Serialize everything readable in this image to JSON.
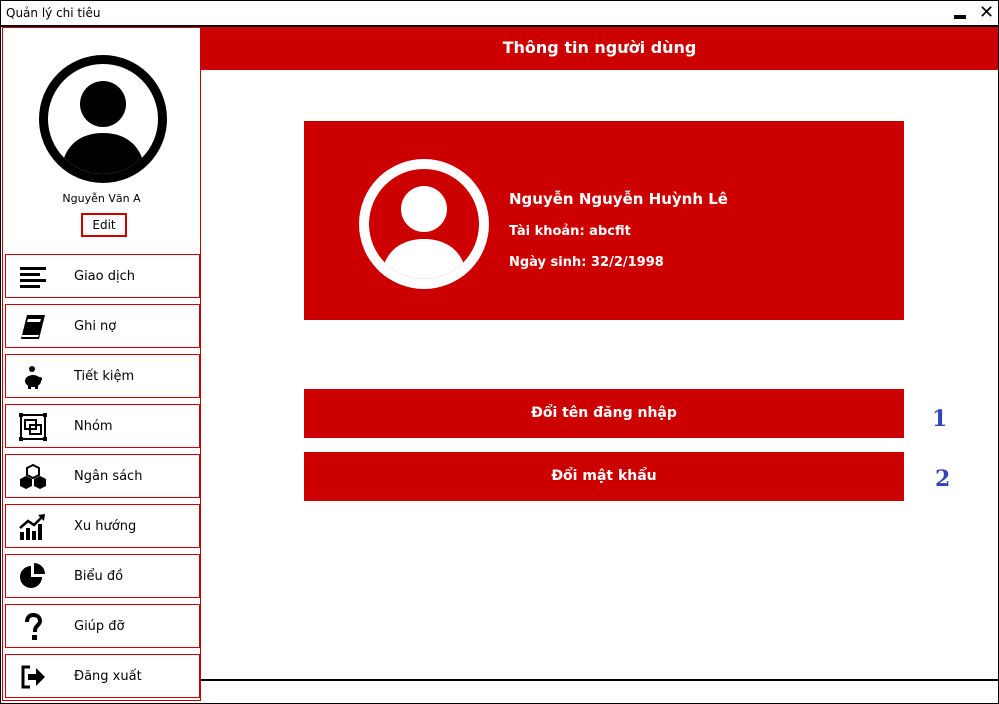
{
  "window": {
    "title": "Quản lý chi tiêu"
  },
  "user": {
    "name": "Nguyễn Văn A",
    "edit_label": "Edit"
  },
  "sidebar": {
    "items": [
      {
        "label": "Giao dịch",
        "icon": "list-icon"
      },
      {
        "label": "Ghi nợ",
        "icon": "book-icon"
      },
      {
        "label": "Tiết kiệm",
        "icon": "piggy-bank-icon"
      },
      {
        "label": "Nhóm",
        "icon": "group-icon"
      },
      {
        "label": "Ngân sách",
        "icon": "cubes-icon"
      },
      {
        "label": "Xu hướng",
        "icon": "trend-chart-icon"
      },
      {
        "label": "Biểu đồ",
        "icon": "pie-chart-icon"
      },
      {
        "label": "Giúp đỡ",
        "icon": "question-icon"
      },
      {
        "label": "Đăng xuất",
        "icon": "logout-icon"
      }
    ]
  },
  "header": {
    "title": "Thông tin người dùng"
  },
  "profile_card": {
    "full_name": "Nguyễn Nguyễn Huỳnh Lê",
    "account": "Tài khoản: abcfit",
    "birthdate": "Ngày sinh: 32/2/1998"
  },
  "actions": {
    "change_username": "Đổi tên đăng nhập",
    "change_password": "Đổi mật khẩu"
  },
  "annotations": {
    "one": "1",
    "two": "2"
  },
  "colors": {
    "accent": "#cc0000",
    "annotation": "#3344bb"
  }
}
